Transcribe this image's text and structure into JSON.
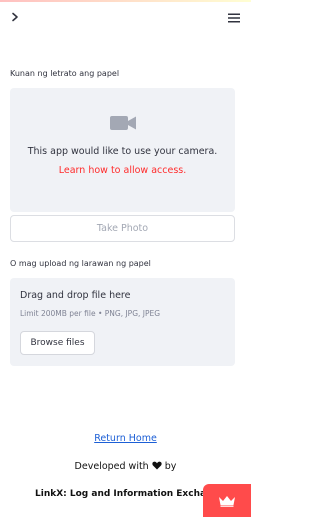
{
  "header": {
    "sidebar_toggle_icon": "chevron-right-icon",
    "menu_icon": "hamburger-menu-icon",
    "top_gradient": [
      "#ff4b4b",
      "#fffd80"
    ]
  },
  "camera": {
    "label": "Kunan ng letrato ang papel",
    "icon": "video-camera-icon",
    "message": "This app would like to use your camera.",
    "link_text": "Learn how to allow access.",
    "take_photo_label": "Take Photo"
  },
  "uploader": {
    "label": "O mag upload ng larawan ng papel",
    "drop_title": "Drag and drop file here",
    "limit_text": "Limit 200MB per file • PNG, JPG, JPEG",
    "browse_label": "Browse files"
  },
  "footer": {
    "return_home": "Return Home",
    "developed_with": "Developed with",
    "heart_icon": "heart-icon",
    "by": "by",
    "brand": "LinkX: Log and Information Exchange"
  },
  "badge": {
    "icon": "crown-icon",
    "color": "#ff4b4b"
  },
  "colors": {
    "accent_red": "#ff2b2b",
    "link_blue": "#1c5fd6",
    "panel_bg": "#f0f2f6"
  }
}
